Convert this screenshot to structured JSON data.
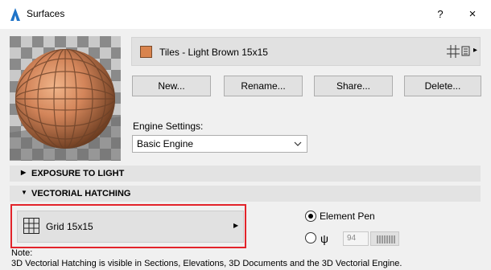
{
  "window": {
    "title": "Surfaces",
    "help_label": "?",
    "close_label": "×"
  },
  "material": {
    "name": "Tiles - Light Brown 15x15",
    "swatch_color": "#d9844e",
    "grid_icon": "grid-icon",
    "menu_arrow": "▸"
  },
  "buttons": {
    "new": "New...",
    "rename": "Rename...",
    "share": "Share...",
    "delete": "Delete..."
  },
  "engine": {
    "label": "Engine Settings:",
    "value": "Basic Engine",
    "chevron": "chevron-down-icon"
  },
  "sections": {
    "exposure": {
      "label": "EXPOSURE TO LIGHT",
      "caret": "▶"
    },
    "hatching": {
      "label": "VECTORIAL HATCHING",
      "caret": "▼"
    }
  },
  "hatching": {
    "pattern_name": "Grid 15x15",
    "arrow": "▶",
    "element_pen_label": "Element Pen",
    "pen_number": "94",
    "pen_icon": "ψ"
  },
  "note": {
    "title": "Note:",
    "text": "3D Vectorial Hatching is visible in Sections, Elevations, 3D Documents and the 3D Vectorial Engine."
  }
}
